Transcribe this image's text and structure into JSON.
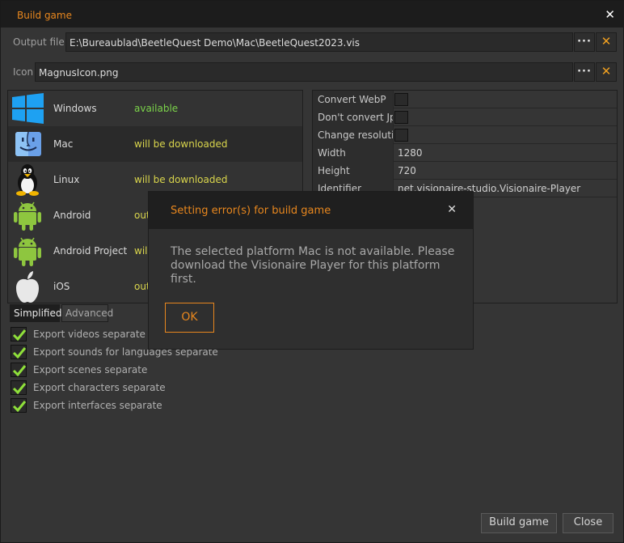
{
  "window": {
    "title": "Build game",
    "close_icon": "close-icon"
  },
  "output": {
    "label": "Output file",
    "value": "E:\\Bureaublad\\BeetleQuest Demo\\Mac\\BeetleQuest2023.vis",
    "browse": "···",
    "clear": "✕"
  },
  "icon": {
    "label": "Icon",
    "value": "MagnusIcon.png",
    "browse": "···",
    "clear": "✕"
  },
  "platforms": [
    {
      "name": "Windows",
      "status": "available",
      "icon": "windows-logo"
    },
    {
      "name": "Mac",
      "status": "will be downloaded",
      "icon": "mac-finder-logo"
    },
    {
      "name": "Linux",
      "status": "will be downloaded",
      "icon": "linux-tux-logo"
    },
    {
      "name": "Android",
      "status": "out",
      "icon": "android-logo"
    },
    {
      "name": "Android Project",
      "status": "will",
      "icon": "android-logo"
    },
    {
      "name": "iOS",
      "status": "out",
      "icon": "apple-logo"
    }
  ],
  "properties": [
    {
      "label": "Convert WebP",
      "type": "checkbox",
      "checked": false
    },
    {
      "label": "Don't convert Jpg",
      "type": "checkbox",
      "checked": false
    },
    {
      "label": "Change resolution",
      "type": "checkbox",
      "checked": false
    },
    {
      "label": "Width",
      "type": "value",
      "value": "1280"
    },
    {
      "label": "Height",
      "type": "value",
      "value": "720"
    },
    {
      "label": "Identifier",
      "type": "value",
      "value": "net.visionaire-studio.Visionaire-Player"
    }
  ],
  "tabs": [
    {
      "label": "Simplified",
      "active": true
    },
    {
      "label": "Advanced",
      "active": false
    }
  ],
  "options": [
    {
      "label": "Export videos separate",
      "checked": true
    },
    {
      "label": "Export sounds for languages separate",
      "checked": true
    },
    {
      "label": "Export scenes separate",
      "checked": true
    },
    {
      "label": "Export characters separate",
      "checked": true
    },
    {
      "label": "Export interfaces separate",
      "checked": true
    }
  ],
  "buttons": {
    "build": "Build game",
    "close": "Close"
  },
  "dialog": {
    "title": "Setting error(s) for build game",
    "close": "✕",
    "message": "The selected platform Mac is not available. Please download the Visionaire Player for this platform first.",
    "ok": "OK"
  },
  "colors": {
    "accent": "#e8871e",
    "available": "#7bd34a",
    "download": "#d9d54c",
    "check": "#8fe03a"
  }
}
